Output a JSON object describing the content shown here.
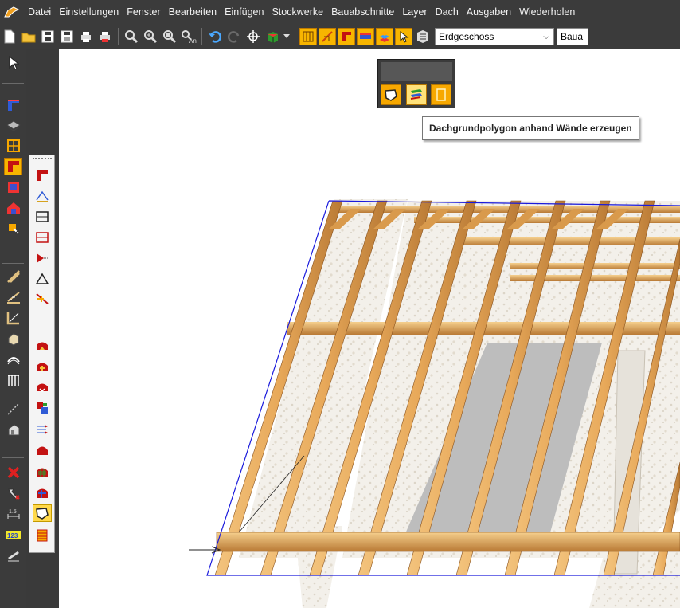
{
  "menu": [
    "Datei",
    "Einstellungen",
    "Fenster",
    "Bearbeiten",
    "Einfügen",
    "Stockwerke",
    "Bauabschnitte",
    "Layer",
    "Dach",
    "Ausgaben",
    "Wiederholen"
  ],
  "toolbar": {
    "floor_combo_value": "Erdgeschoss",
    "section_combo_value": "Baua"
  },
  "tooltip": "Dachgrundpolygon anhand Wände erzeugen",
  "colors": {
    "chrome": "#3b3b3b",
    "accent": "#f7b500",
    "timber": "#d89448",
    "selection": "#1a1adc"
  }
}
